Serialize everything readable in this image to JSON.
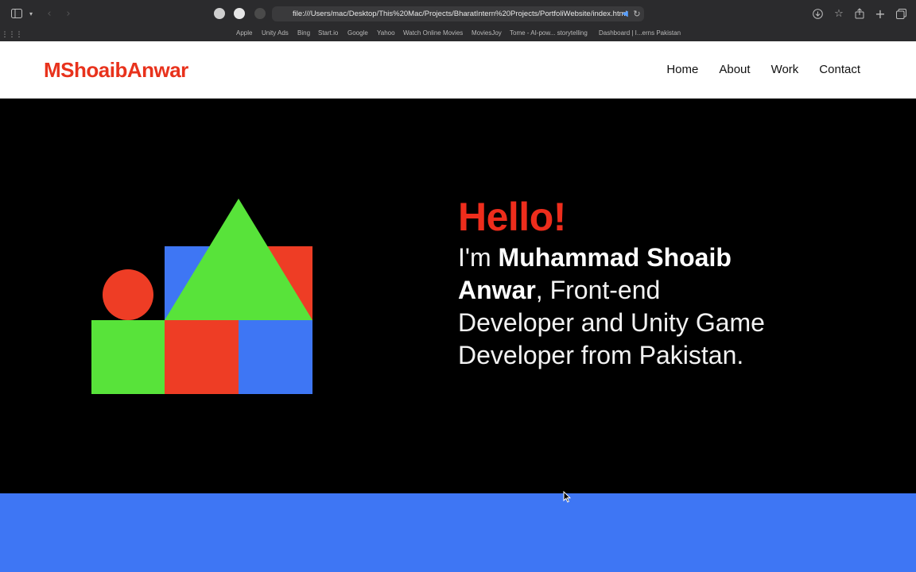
{
  "browser": {
    "address": "file:///Users/mac/Desktop/This%20Mac/Projects/BharatIntern%20Projects/PortfoliWebsite/index.html",
    "bookmarks": [
      "Apple",
      "Unity Ads",
      "Bing",
      "Start.io",
      "Google",
      "Yahoo",
      "Watch Online Movies",
      "MoviesJoy",
      "Tome - AI-pow... storytelling",
      "Dashboard | I...erns Pakistan"
    ]
  },
  "site": {
    "logo": "MShoaibAnwar",
    "nav": [
      "Home",
      "About",
      "Work",
      "Contact"
    ]
  },
  "hero": {
    "greeting": "Hello!",
    "intro_prefix": "I'm ",
    "name": "Muhammad Shoaib Anwar",
    "intro_suffix": ", Front-end Developer and Unity Game Developer from Pakistan."
  },
  "colors": {
    "brand_red": "#e8321c",
    "green": "#58e33a",
    "blue": "#3e76f4",
    "black": "#000000"
  }
}
